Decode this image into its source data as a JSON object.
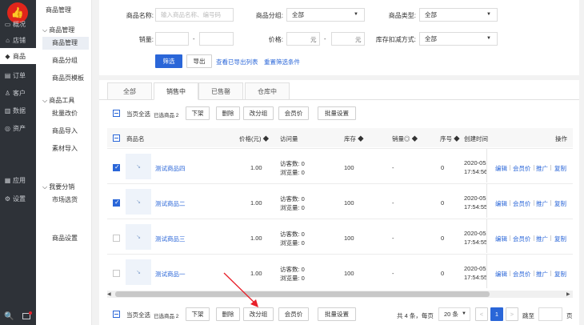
{
  "sidebar": {
    "logo": "👍",
    "items": [
      {
        "icon": "▭",
        "label": "概况"
      },
      {
        "icon": "⌂",
        "label": "店铺"
      },
      {
        "icon": "◆",
        "label": "商品"
      },
      {
        "icon": "▤",
        "label": "订单"
      },
      {
        "icon": "♙",
        "label": "客户"
      },
      {
        "icon": "▥",
        "label": "数据"
      },
      {
        "icon": "◎",
        "label": "资产"
      },
      {
        "icon": "▦",
        "label": "应用"
      },
      {
        "icon": "⚙",
        "label": "设置"
      }
    ],
    "search_icon": "🔍",
    "msg_icon": "▭"
  },
  "submenu": {
    "title": "商品管理",
    "groups": [
      {
        "header": "商品管理",
        "items": [
          "商品管理",
          "商品分组",
          "商品页模板"
        ]
      },
      {
        "header": "商品工具",
        "items": [
          "批量改价",
          "商品导入",
          "素材导入"
        ]
      },
      {
        "header": "我要分销",
        "items": [
          "市场选货"
        ]
      }
    ],
    "settings": "商品设置"
  },
  "filters": {
    "name_label": "商品名称:",
    "name_placeholder": "输入商品名称、编号码",
    "group_label": "商品分组:",
    "group_value": "全部",
    "type_label": "商品类型:",
    "type_value": "全部",
    "sales_label": "销量:",
    "dash": "-",
    "price_label": "价格:",
    "yuan": "元",
    "stock_label": "库存扣减方式:",
    "stock_value": "全部",
    "filter_btn": "筛选",
    "export_btn": "导出",
    "view_export": "查看已导出列表",
    "reset": "重置筛选条件"
  },
  "tabs": [
    "全部",
    "销售中",
    "已售罄",
    "仓库中"
  ],
  "bulk": {
    "select_all": "当页全选",
    "selected": "已选商品 2",
    "actions": [
      "下架",
      "删除",
      "改分组",
      "会员价",
      "批量设置"
    ]
  },
  "columns": {
    "name": "商品名",
    "price": "价格(元) ◆",
    "visits": "访问量",
    "stock": "库存 ◆",
    "sales": "销量◎ ◆",
    "seq": "序号 ◆",
    "created": "创建时间",
    "ops": "操作"
  },
  "rows": [
    {
      "checked": true,
      "thumb": "↘",
      "name": "测试商品四",
      "price": "1.00",
      "visitors": "访客数: 0",
      "views": "浏览量: 0",
      "stock": "100",
      "sales": "-",
      "seq": "0",
      "date": "2020-05",
      "time": "17:54:56"
    },
    {
      "checked": true,
      "thumb": "↘",
      "name": "测试商品二",
      "price": "1.00",
      "visitors": "访客数: 0",
      "views": "浏览量: 0",
      "stock": "100",
      "sales": "-",
      "seq": "0",
      "date": "2020-05",
      "time": "17:54:55"
    },
    {
      "checked": false,
      "thumb": "↘",
      "name": "测试商品三",
      "price": "1.00",
      "visitors": "访客数: 0",
      "views": "浏览量: 0",
      "stock": "100",
      "sales": "-",
      "seq": "0",
      "date": "2020-05",
      "time": "17:54:55"
    },
    {
      "checked": false,
      "thumb": "↘",
      "name": "测试商品一",
      "price": "1.00",
      "visitors": "访客数: 0",
      "views": "浏览量: 0",
      "stock": "100",
      "sales": "-",
      "seq": "0",
      "date": "2020-05",
      "time": "17:54:55"
    }
  ],
  "row_ops": [
    "编辑",
    "会员价",
    "推广",
    "复制"
  ],
  "pagination": {
    "total": "共 4 条，每页",
    "per_page": "20 条",
    "prev": "<",
    "page": "1",
    "next": ">",
    "goto": "跳至",
    "page_unit": "页"
  }
}
